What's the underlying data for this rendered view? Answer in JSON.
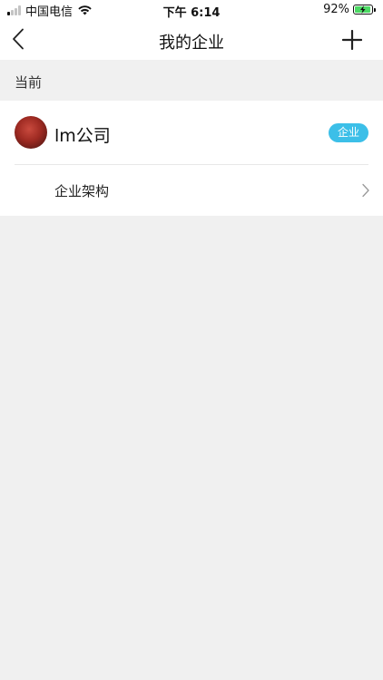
{
  "status_bar": {
    "carrier": "中国电信",
    "time": "下午 6:14",
    "battery_percent": "92%",
    "battery_level": 0.92,
    "signal_bars_active": 1,
    "signal_bars_total": 4,
    "icons": [
      "signal-icon",
      "wifi-icon",
      "battery-icon"
    ]
  },
  "nav": {
    "title": "我的企业",
    "back_icon": "chevron-left-icon",
    "add_icon": "plus-icon"
  },
  "section": {
    "header": "当前"
  },
  "company": {
    "name": "lm公司",
    "badge": "企业",
    "badge_color": "#3cbfe8",
    "org_label": "企业架构",
    "org_icon": "chevron-right-icon"
  }
}
